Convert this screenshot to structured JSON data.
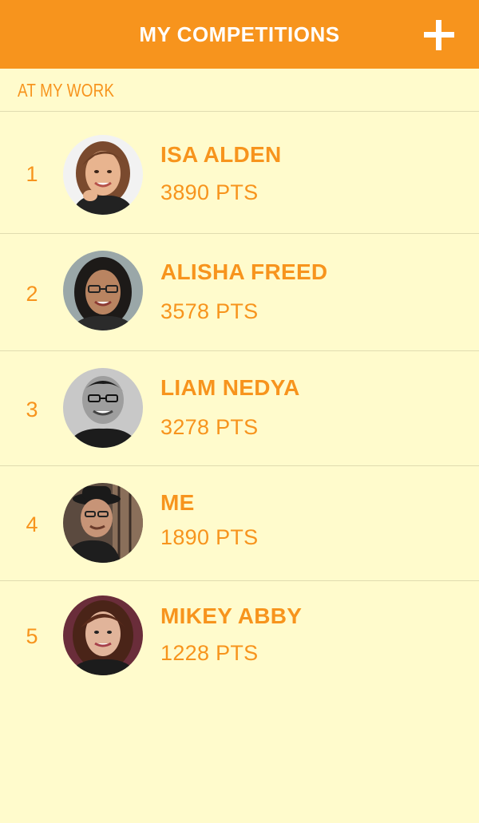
{
  "header": {
    "title": "MY COMPETITIONS",
    "add_icon": "plus-icon",
    "background_color": "#f7941d"
  },
  "section": {
    "label": "AT MY WORK"
  },
  "colors": {
    "accent": "#f7941d",
    "background": "#fffbcc",
    "divider": "#e0dcb0"
  },
  "competitors": [
    {
      "rank": "1",
      "name": "ISA ALDEN",
      "points": "3890 PTS"
    },
    {
      "rank": "2",
      "name": "ALISHA FREED",
      "points": "3578 PTS"
    },
    {
      "rank": "3",
      "name": "LIAM NEDYA",
      "points": "3278 PTS"
    },
    {
      "rank": "4",
      "name": "ME",
      "points": "1890 PTS"
    },
    {
      "rank": "5",
      "name": "MIKEY ABBY",
      "points": "1228 PTS"
    }
  ]
}
